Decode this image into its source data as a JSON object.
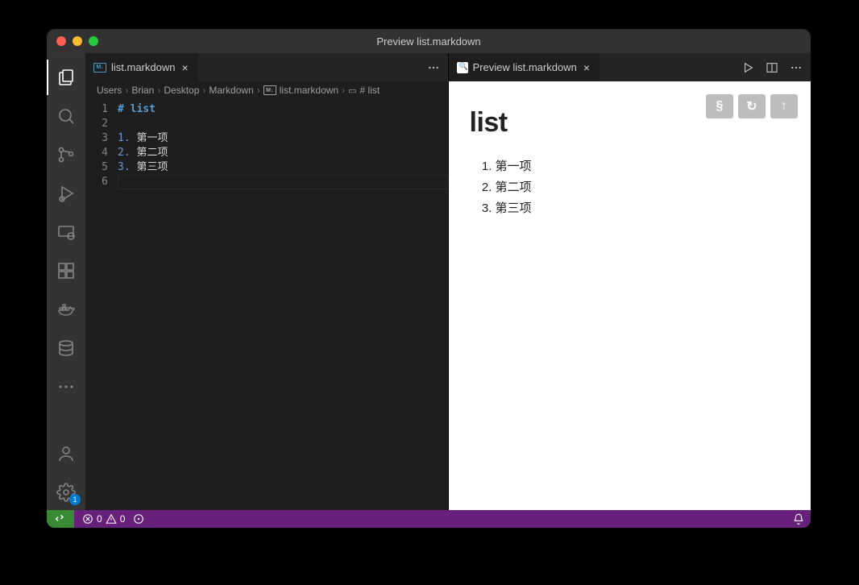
{
  "window": {
    "title": "Preview list.markdown"
  },
  "tabs": {
    "left": {
      "icon_label": "M↓",
      "label": "list.markdown"
    },
    "right": {
      "label": "Preview list.markdown"
    }
  },
  "breadcrumb": {
    "items": [
      "Users",
      "Brian",
      "Desktop",
      "Markdown",
      "list.markdown",
      "# list"
    ],
    "md_icon_label": "M↓",
    "header_icon_label": "♯"
  },
  "editor": {
    "lines": [
      {
        "n": "1",
        "type": "title",
        "prefix": "# ",
        "text": "list"
      },
      {
        "n": "2",
        "type": "blank",
        "prefix": "",
        "text": ""
      },
      {
        "n": "3",
        "type": "item",
        "prefix": "1.",
        "text": " 第一项"
      },
      {
        "n": "4",
        "type": "item",
        "prefix": "2.",
        "text": " 第二项"
      },
      {
        "n": "5",
        "type": "item",
        "prefix": "3.",
        "text": " 第三项"
      },
      {
        "n": "6",
        "type": "blank",
        "prefix": "",
        "text": ""
      }
    ]
  },
  "preview": {
    "heading": "list",
    "items": [
      "第一项",
      "第二项",
      "第三项"
    ],
    "toolbar_glyphs": {
      "section": "§",
      "refresh": "↻",
      "top": "↑"
    }
  },
  "statusbar": {
    "errors": "0",
    "warnings": "0"
  },
  "activity": {
    "settings_badge": "1"
  }
}
